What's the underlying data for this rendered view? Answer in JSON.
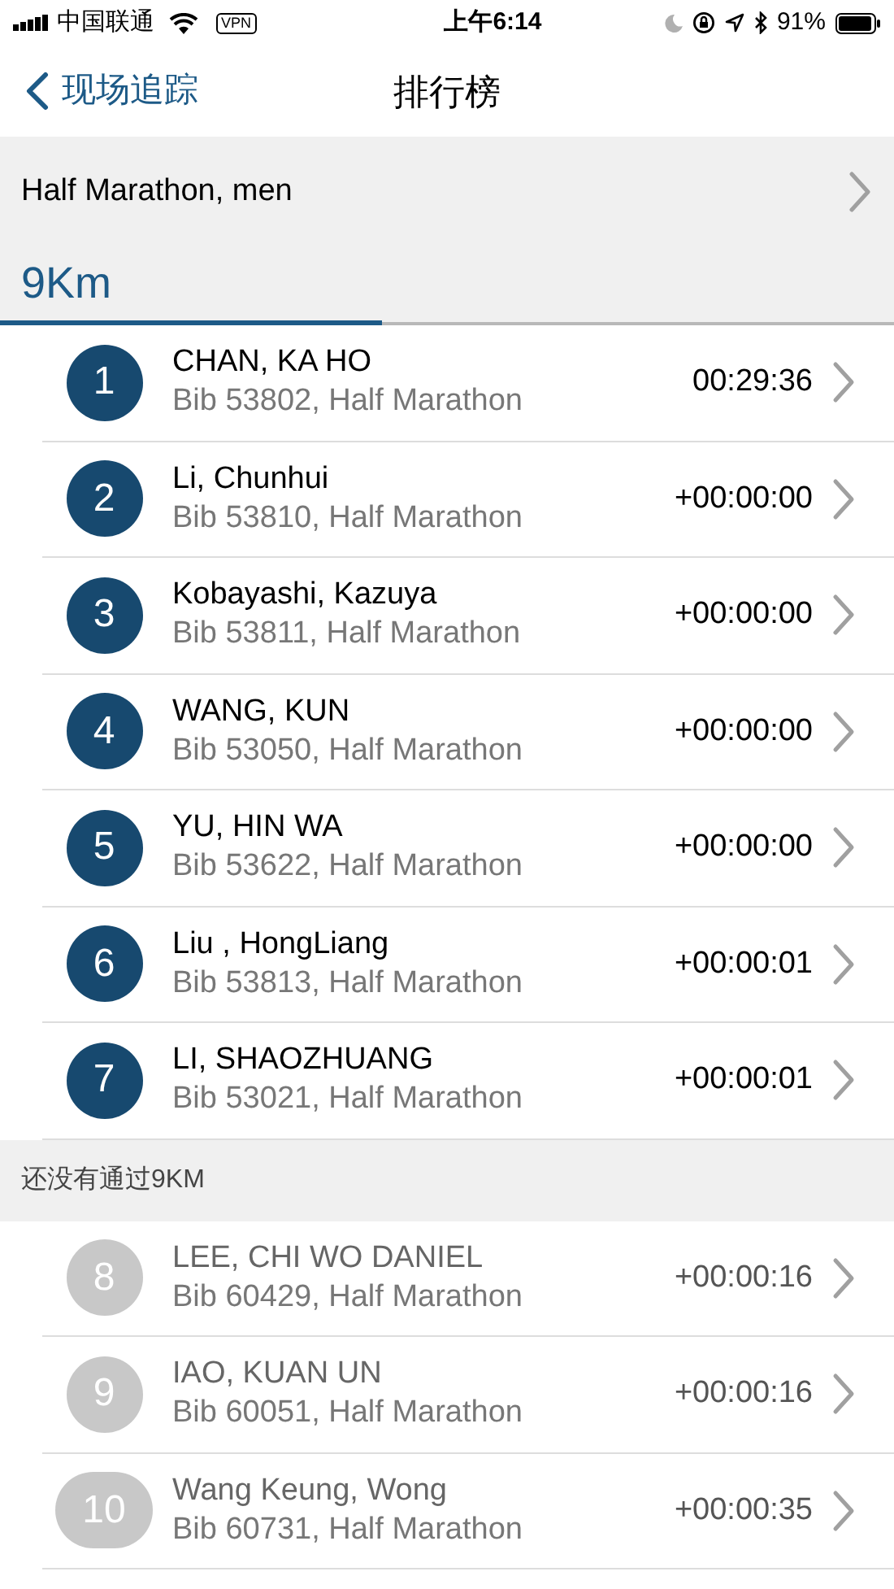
{
  "status_bar": {
    "carrier": "中国联通",
    "vpn": "VPN",
    "time": "上午6:14",
    "battery_text": "91%"
  },
  "nav": {
    "back_label": "现场追踪",
    "title": "排行榜"
  },
  "category": {
    "label": "Half Marathon, men"
  },
  "tabs": [
    {
      "label": "9Km",
      "selected": true
    }
  ],
  "sections": [
    {
      "kind": "passed",
      "runners": [
        {
          "rank": "1",
          "name": "CHAN, KA HO",
          "detail": "Bib 53802, Half Marathon",
          "time": "00:29:36"
        },
        {
          "rank": "2",
          "name": "Li, Chunhui",
          "detail": "Bib 53810, Half Marathon",
          "time": "+00:00:00"
        },
        {
          "rank": "3",
          "name": "Kobayashi, Kazuya",
          "detail": "Bib 53811, Half Marathon",
          "time": "+00:00:00"
        },
        {
          "rank": "4",
          "name": "WANG, KUN",
          "detail": "Bib 53050, Half Marathon",
          "time": "+00:00:00"
        },
        {
          "rank": "5",
          "name": "YU, HIN WA",
          "detail": "Bib 53622, Half Marathon",
          "time": "+00:00:00"
        },
        {
          "rank": "6",
          "name": "Liu , HongLiang",
          "detail": "Bib 53813, Half Marathon",
          "time": "+00:00:01"
        },
        {
          "rank": "7",
          "name": "LI, SHAOZHUANG",
          "detail": "Bib 53021, Half Marathon",
          "time": "+00:00:01"
        }
      ]
    },
    {
      "kind": "pending",
      "header": "还没有通过9KM",
      "runners": [
        {
          "rank": "8",
          "name": "LEE, CHI WO DANIEL",
          "detail": "Bib 60429, Half Marathon",
          "time": "+00:00:16"
        },
        {
          "rank": "9",
          "name": "IAO, KUAN UN",
          "detail": "Bib 60051, Half Marathon",
          "time": "+00:00:16"
        },
        {
          "rank": "10",
          "name": "Wang Keung, Wong",
          "detail": "Bib 60731, Half Marathon",
          "time": "+00:00:35"
        }
      ]
    }
  ]
}
